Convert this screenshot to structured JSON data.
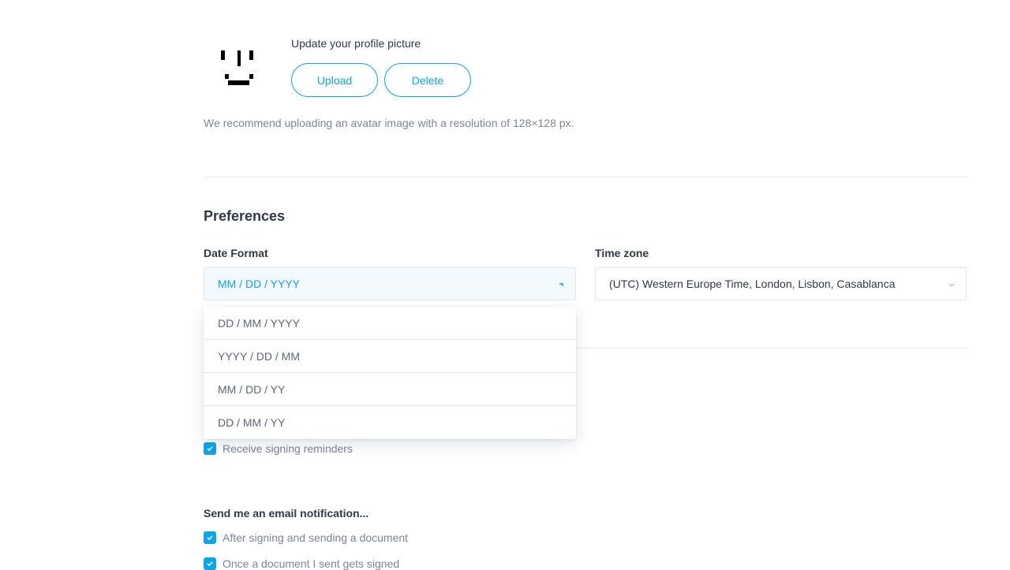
{
  "profile": {
    "heading": "Update your profile picture",
    "upload_label": "Upload",
    "delete_label": "Delete",
    "hint": "We recommend uploading an avatar image with a resolution of 128×128 px."
  },
  "preferences": {
    "title": "Preferences",
    "date_format": {
      "label": "Date Format",
      "selected": "MM / DD / YYYY",
      "options": [
        "DD / MM / YYYY",
        "YYYY / DD / MM",
        "MM / DD / YY",
        "DD / MM / YY"
      ]
    },
    "time_zone": {
      "label": "Time zone",
      "selected": "(UTC) Western Europe Time, London, Lisbon, Casablanca"
    }
  },
  "reminders": {
    "signing_reminders": {
      "label": "Receive signing reminders",
      "checked": true
    }
  },
  "email_notifications": {
    "heading": "Send me an email notification...",
    "items": [
      {
        "label": "After signing and sending a document",
        "checked": true
      },
      {
        "label": "Once a document I sent gets signed",
        "checked": true
      }
    ]
  },
  "colors": {
    "accent": "#0ea5e9",
    "text": "#2e3a48",
    "muted": "#7c8594"
  },
  "icons": {
    "avatar": "pixel-face-icon",
    "checkbox": "checkmark-icon",
    "select": "chevron-down-icon"
  }
}
